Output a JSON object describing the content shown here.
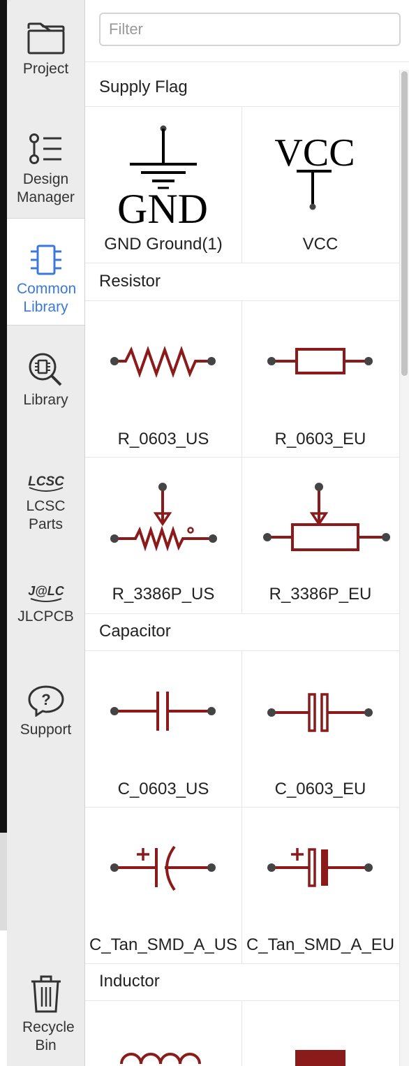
{
  "sidebar": {
    "items": [
      {
        "label": "Project",
        "icon": "folder-icon"
      },
      {
        "label": "Design Manager",
        "icon": "list-tree-icon"
      },
      {
        "label": "Common Library",
        "icon": "chip-icon",
        "active": true
      },
      {
        "label": "Library",
        "icon": "search-chip-icon"
      },
      {
        "label": "LCSC Parts",
        "icon": "lcsc-logo-icon",
        "logo_text": "LCSC"
      },
      {
        "label": "JLCPCB",
        "icon": "jlc-logo-icon",
        "logo_text": "J@LC"
      },
      {
        "label": "Support",
        "icon": "help-bubble-icon"
      },
      {
        "label": "Recycle Bin",
        "icon": "trash-icon"
      }
    ]
  },
  "filter": {
    "placeholder": "Filter",
    "value": ""
  },
  "categories": [
    {
      "name": "Supply Flag",
      "items": [
        {
          "label": "GND Ground(1)",
          "symbol_text": "GND"
        },
        {
          "label": "VCC",
          "symbol_text": "VCC"
        }
      ]
    },
    {
      "name": "Resistor",
      "items": [
        {
          "label": "R_0603_US"
        },
        {
          "label": "R_0603_EU"
        },
        {
          "label": "R_3386P_US"
        },
        {
          "label": "R_3386P_EU"
        }
      ]
    },
    {
      "name": "Capacitor",
      "items": [
        {
          "label": "C_0603_US"
        },
        {
          "label": "C_0603_EU"
        },
        {
          "label": "C_Tan_SMD_A_US"
        },
        {
          "label": "C_Tan_SMD_A_EU"
        }
      ]
    },
    {
      "name": "Inductor",
      "items": []
    }
  ],
  "colors": {
    "accent": "#3c78d8",
    "symbol": "#8b1a1a",
    "pin": "#444444"
  }
}
